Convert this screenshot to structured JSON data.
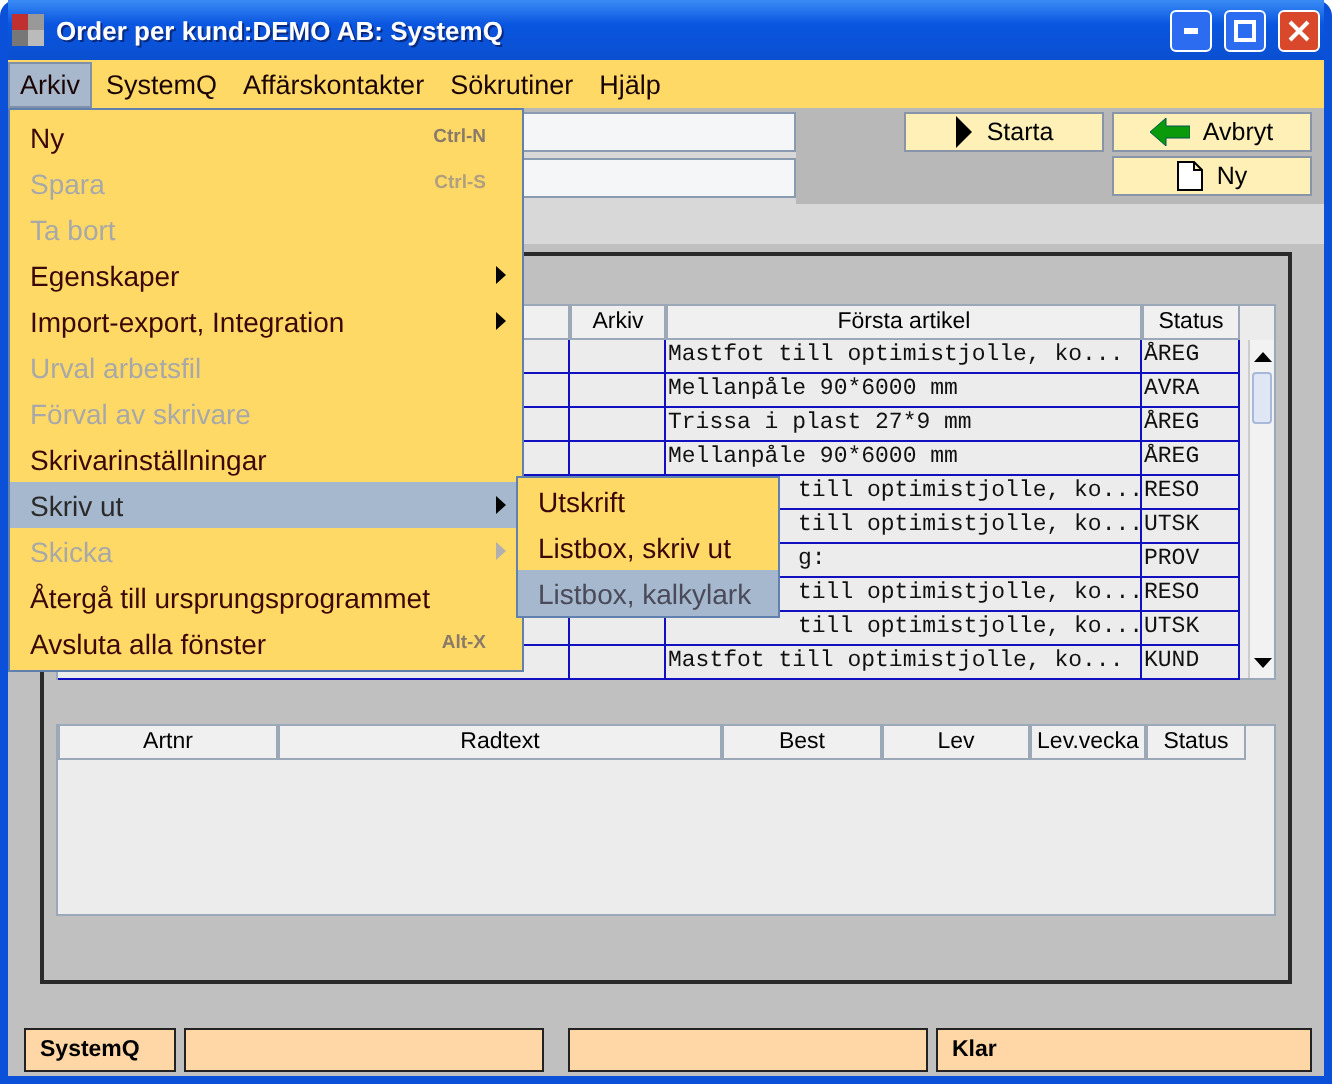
{
  "window": {
    "title": "Order per kund:DEMO AB: SystemQ"
  },
  "menubar": [
    {
      "label": "Arkiv",
      "selected": true
    },
    {
      "label": "SystemQ",
      "selected": false
    },
    {
      "label": "Affärskontakter",
      "selected": false
    },
    {
      "label": "Sökrutiner",
      "selected": false
    },
    {
      "label": "Hjälp",
      "selected": false
    }
  ],
  "toolbar": {
    "buttons": [
      {
        "label": "Starta",
        "kind": "play"
      },
      {
        "label": "Avbryt",
        "kind": "back"
      },
      {
        "label": "Ny",
        "kind": "new"
      }
    ]
  },
  "orders_table": {
    "columns": [
      {},
      {
        "label": "Arkiv"
      },
      {
        "label": "Första artikel"
      },
      {
        "label": "Status"
      }
    ],
    "rows": [
      {
        "first_article": "Mastfot till optimistjolle, ko...",
        "status": "ÅREG",
        "kind": "full"
      },
      {
        "first_article": "Mellanpåle 90*6000 mm",
        "status": "AVRA",
        "kind": "full"
      },
      {
        "first_article": "Trissa i plast 27*9 mm",
        "status": "ÅREG",
        "kind": "full"
      },
      {
        "first_article": "Mellanpåle 90*6000 mm",
        "status": "ÅREG",
        "kind": "full"
      },
      {
        "first_article": "till optimistjolle, ko...",
        "status": "RESO",
        "kind": "partial"
      },
      {
        "first_article": "till optimistjolle, ko...",
        "status": "UTSK",
        "kind": "partial"
      },
      {
        "first_article": "g:",
        "status": "PROV",
        "kind": "partial"
      },
      {
        "first_article": "till optimistjolle, ko...",
        "status": "RESO",
        "kind": "partial"
      },
      {
        "first_article": "till optimistjolle, ko...",
        "status": "UTSK",
        "kind": "partial"
      },
      {
        "first_article": "Mastfot till optimistjolle, ko...",
        "status": "KUND",
        "kind": "full"
      }
    ]
  },
  "lines_table": {
    "columns": [
      "Artnr",
      "Radtext",
      "Best",
      "Lev",
      "Lev.vecka",
      "Status"
    ]
  },
  "status_bar": {
    "left": "SystemQ",
    "right": "Klar"
  },
  "menu": {
    "items": [
      {
        "label": "Ny",
        "shortcut": "Ctrl-N",
        "disabled": false,
        "submenu": false,
        "selected": false
      },
      {
        "label": "Spara",
        "shortcut": "Ctrl-S",
        "disabled": true,
        "submenu": false,
        "selected": false
      },
      {
        "label": "Ta bort",
        "disabled": true,
        "submenu": false,
        "selected": false
      },
      {
        "label": "Egenskaper",
        "disabled": false,
        "submenu": true,
        "selected": false
      },
      {
        "label": "Import-export, Integration",
        "disabled": false,
        "submenu": true,
        "selected": false
      },
      {
        "label": "Urval arbetsfil",
        "disabled": true,
        "submenu": false,
        "selected": false
      },
      {
        "label": "Förval av skrivare",
        "disabled": true,
        "submenu": false,
        "selected": false
      },
      {
        "label": "Skrivarinställningar",
        "disabled": false,
        "submenu": false,
        "selected": false
      },
      {
        "label": "Skriv ut",
        "disabled": false,
        "submenu": true,
        "selected": true
      },
      {
        "label": "Skicka",
        "disabled": true,
        "submenu": true,
        "selected": false
      },
      {
        "label": "Återgå till ursprungsprogrammet",
        "disabled": false,
        "submenu": false,
        "selected": false
      },
      {
        "label": "Avsluta alla fönster",
        "shortcut": "Alt-X",
        "disabled": false,
        "submenu": false,
        "selected": false
      }
    ],
    "submenu": [
      {
        "label": "Utskrift",
        "selected": false
      },
      {
        "label": "Listbox, skriv ut",
        "selected": false
      },
      {
        "label": "Listbox, kalkylark",
        "selected": true
      }
    ]
  }
}
